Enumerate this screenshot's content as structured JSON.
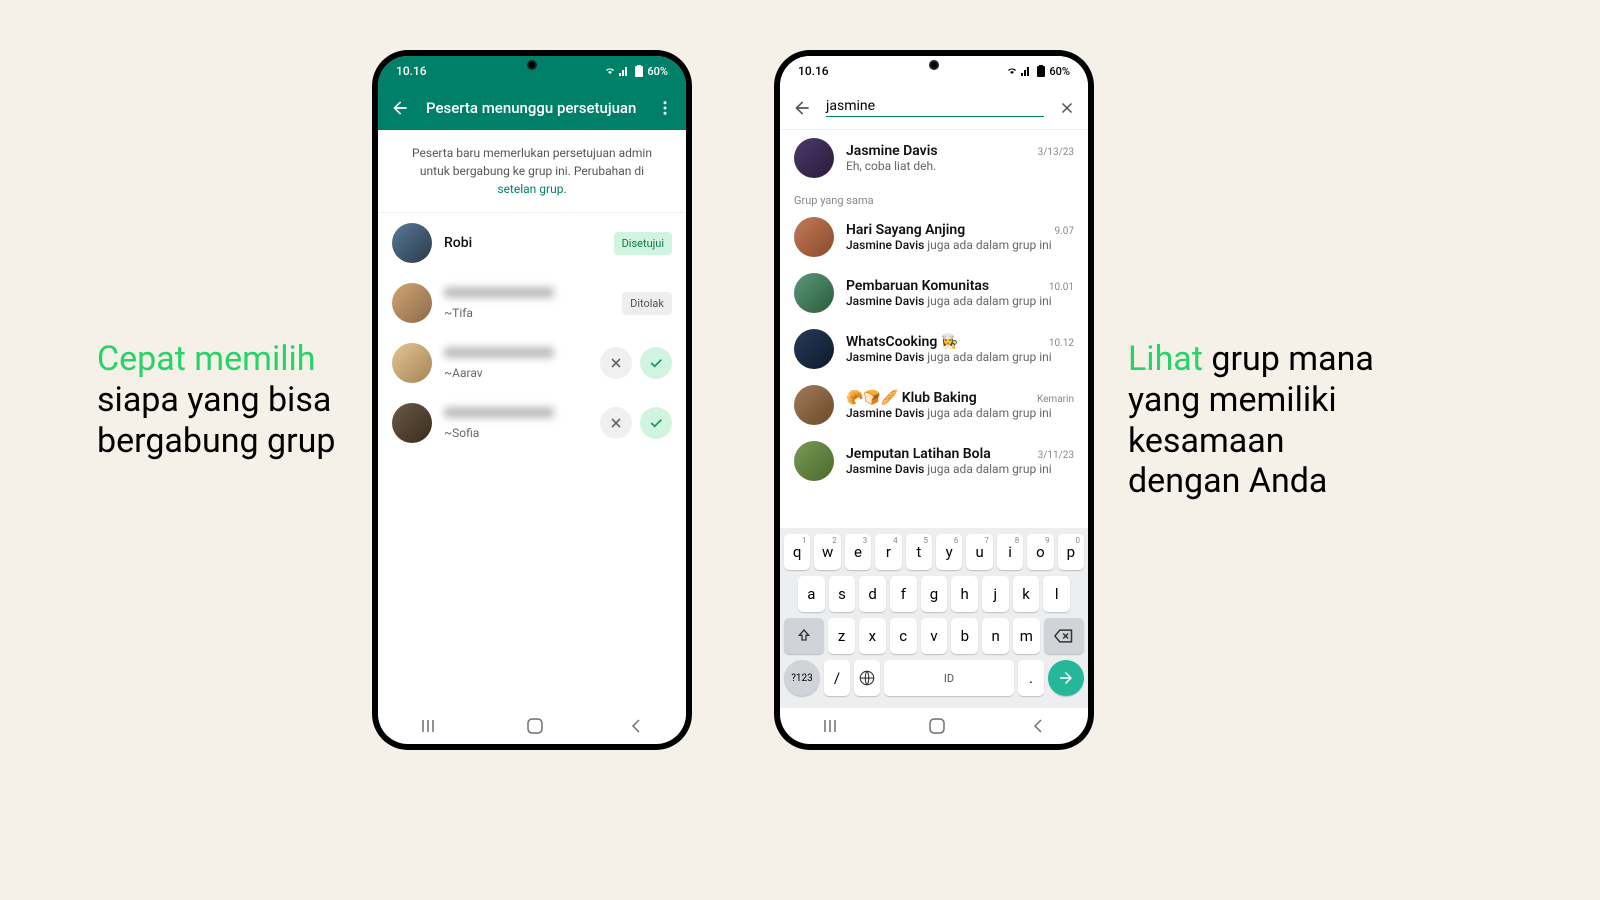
{
  "captions": {
    "left_green": "Cepat memilih",
    "left_rest": " siapa yang bisa bergabung grup",
    "right_green": "Lihat",
    "right_rest": " grup mana yang memiliki kesamaan dengan Anda"
  },
  "status": {
    "time": "10.16",
    "battery": "60%"
  },
  "phone1": {
    "title": "Peserta menunggu persetujuan",
    "banner": "Peserta baru memerlukan persetujuan admin untuk bergabung ke grup ini. Perubahan di ",
    "banner_link": "setelan grup",
    "approved": "Disetujui",
    "rejected": "Ditolak",
    "rows": [
      {
        "name": "Robi",
        "status": "approved"
      },
      {
        "sub": "~Tifa",
        "status": "rejected"
      },
      {
        "sub": "~Aarav",
        "status": "pending"
      },
      {
        "sub": "~Sofia",
        "status": "pending"
      }
    ]
  },
  "phone2": {
    "search": "jasmine",
    "section": "Grup yang sama",
    "in_group": " juga ada dalam grup ini",
    "hl_name": "Jasmine Davis",
    "contact": {
      "name": "Jasmine Davis",
      "msg": "Eh, coba liat deh.",
      "time": "3/13/23"
    },
    "groups": [
      {
        "name": "Hari Sayang Anjing",
        "time": "9.07"
      },
      {
        "name": "Pembaruan Komunitas",
        "time": "10.01"
      },
      {
        "name": "WhatsCooking 👩‍🍳",
        "time": "10.12"
      },
      {
        "name": "🥐🍞🥖 Klub Baking",
        "time": "Kemarin"
      },
      {
        "name": "Jemputan Latihan Bola",
        "time": "3/11/23"
      }
    ]
  },
  "keyboard": {
    "r1": [
      "q",
      "w",
      "e",
      "r",
      "t",
      "y",
      "u",
      "i",
      "o",
      "p"
    ],
    "nums": [
      "1",
      "2",
      "3",
      "4",
      "5",
      "6",
      "7",
      "8",
      "9",
      "0"
    ],
    "r2": [
      "a",
      "s",
      "d",
      "f",
      "g",
      "h",
      "j",
      "k",
      "l"
    ],
    "r3": [
      "z",
      "x",
      "c",
      "v",
      "b",
      "n",
      "m"
    ],
    "sym": "?123",
    "slash": "/",
    "space": "ID",
    "dot": "."
  }
}
